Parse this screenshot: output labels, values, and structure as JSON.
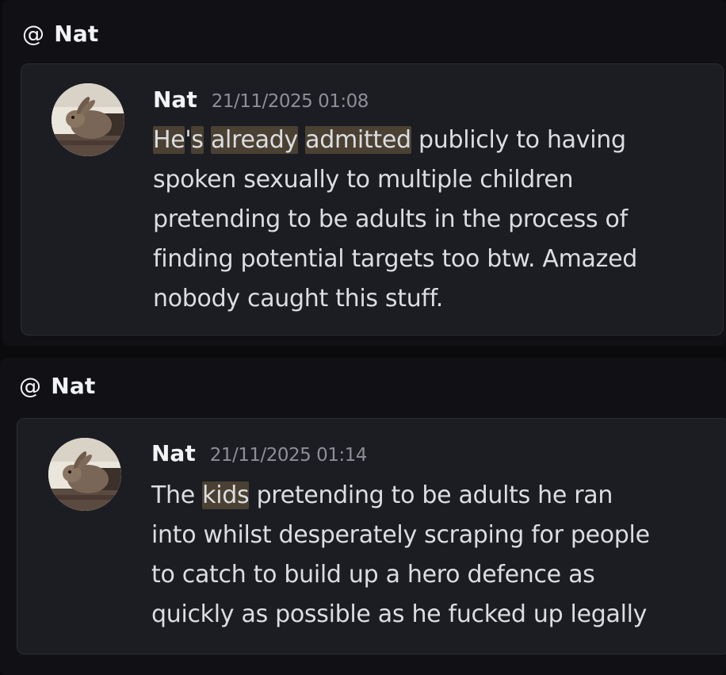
{
  "results": [
    {
      "mention": {
        "symbol": "@",
        "name": "Nat"
      },
      "author": "Nat",
      "timestamp": "21/11/2025 01:08",
      "lines": [
        [
          {
            "text": "He",
            "hl": true
          },
          {
            "text": "'",
            "hl": false
          },
          {
            "text": "s",
            "hl": true
          },
          {
            "text": " ",
            "hl": false
          },
          {
            "text": "already",
            "hl": true
          },
          {
            "text": " ",
            "hl": false
          },
          {
            "text": "admitted",
            "hl": true
          },
          {
            "text": " publicly to having",
            "hl": false
          }
        ],
        [
          {
            "text": "spoken sexually to multiple children",
            "hl": false
          }
        ],
        [
          {
            "text": "pretending to be adults in the process of",
            "hl": false
          }
        ],
        [
          {
            "text": "finding potential targets too btw. Amazed",
            "hl": false
          }
        ],
        [
          {
            "text": "nobody caught this stuff.",
            "hl": false
          }
        ]
      ]
    },
    {
      "mention": {
        "symbol": "@",
        "name": "Nat"
      },
      "author": "Nat",
      "timestamp": "21/11/2025 01:14",
      "lines": [
        [
          {
            "text": "The ",
            "hl": false
          },
          {
            "text": "kids",
            "hl": true
          },
          {
            "text": " pretending to be adults he ran",
            "hl": false
          }
        ],
        [
          {
            "text": "into whilst desperately scraping for people",
            "hl": false
          }
        ],
        [
          {
            "text": "to catch to build up a hero defence as",
            "hl": false
          }
        ],
        [
          {
            "text": "quickly as possible as he fucked up legally",
            "hl": false
          }
        ]
      ]
    }
  ],
  "avatar_icon": "rabbit-photo",
  "colors": {
    "page_bg": "#0b0b0e",
    "card_bg": "#111115",
    "message_bg": "#1c1d22",
    "highlight": "#4a4133",
    "text": "#dcdde1",
    "muted": "#8d8f97"
  }
}
